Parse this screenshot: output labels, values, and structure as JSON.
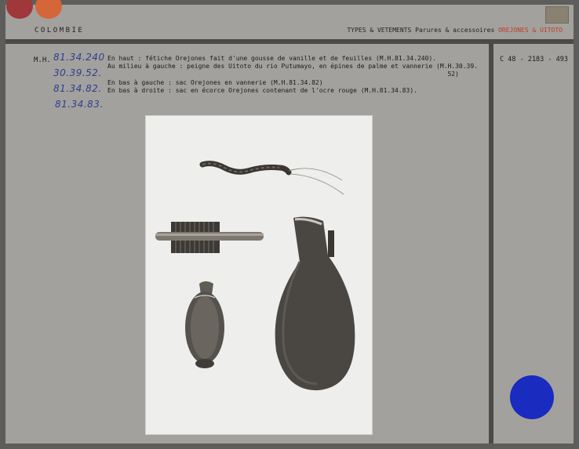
{
  "header": {
    "country": "COLOMBIE",
    "category_prefix": "TYPES & VETEMENTS Parures & accessoires",
    "category_highlight": "OREJONES & UITOTO"
  },
  "record": {
    "prefix": "M.H.",
    "inventory_numbers": [
      "81.34.240",
      "30.39.52.",
      "81.34.82.",
      "81.34.83."
    ],
    "description_lines": [
      "En haut : fétiche Orejones fait d'une gousse de vanille et de feuilles (M.H.81.34.240).",
      "Au milieu à gauche : peigne des Uitoto du rio Putumayo, en épines de palme et vannerie (M.H.30.39.",
      "                                                                                          52)",
      "En bas à gauche : sac Orejones en vannerie (M.H.81.34.82)",
      "En bas à droite : sac en écorce Orejones contenant de l'ocre rouge (M.H.81.34.83)."
    ],
    "reference": "C  48 - 2183 - 493"
  },
  "colors": {
    "card": "#a3a19d",
    "border": "#4a4a48",
    "handwriting": "#2f3f8f",
    "highlight": "#c0392b",
    "blue_dot": "#1a2bc0",
    "red_dot": "#a0373a",
    "orange_dot": "#d4663a"
  }
}
